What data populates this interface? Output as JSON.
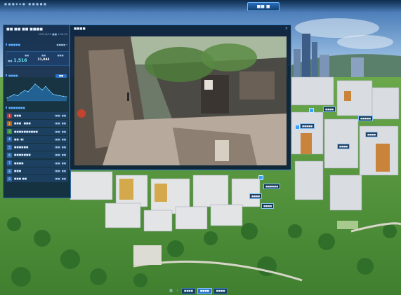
{
  "topbar": {
    "status": "■ ■ ■ ◆ ◆ ■ · ■ ■ ■ ■ ■",
    "title": "■■ ■"
  },
  "left_panel": {
    "title": "■■ ■■ ■■ ■■■■",
    "time": "2021/3/10 ■■ 1:34:40",
    "section1": {
      "title": "■■■■■",
      "right": "■■■■ ▾"
    },
    "stats": {
      "main_label": "■■",
      "main_value": "1,516",
      "cols": [
        {
          "label": "■■",
          "value": ""
        },
        {
          "label": "■■",
          "value": "21,844"
        },
        {
          "label": "■■■",
          "value": ""
        }
      ]
    },
    "section2": {
      "title": "■■■■",
      "button": "■■"
    },
    "chart_data": {
      "type": "area",
      "values": [
        5,
        8,
        11,
        9,
        14,
        18,
        16,
        22,
        29,
        24,
        19,
        25,
        18,
        12,
        10,
        9,
        8,
        7
      ]
    },
    "section3": {
      "title": "■■■■■■■"
    },
    "items": [
      {
        "index": "1",
        "name": "■■■",
        "count": "(■■) ■■",
        "color": "#b03a3a"
      },
      {
        "index": "2",
        "name": "■■■ · ■■■",
        "count": "(■■) ■■",
        "color": "#b5651d"
      },
      {
        "index": "3",
        "name": "■■■■■■■■■■",
        "count": "(■■) ■■",
        "color": "#3a8f3a"
      },
      {
        "index": "4",
        "name": "■■ (■)",
        "count": "(■■) ■■",
        "color": "#2e6db4"
      },
      {
        "index": "5",
        "name": "■■■■■■",
        "count": "(■■) ■■",
        "color": "#2e6db4"
      },
      {
        "index": "6",
        "name": "■■■■■■■",
        "count": "(■■) ■■",
        "color": "#2e6db4"
      },
      {
        "index": "7",
        "name": "■■■■",
        "count": "(■■) ■■",
        "color": "#2e6db4"
      },
      {
        "index": "8",
        "name": "■■■",
        "count": "(■■) ■■",
        "color": "#2e6db4"
      },
      {
        "index": "9",
        "name": "■■■ ■■",
        "count": "(■■) ■■",
        "color": "#2e6db4"
      }
    ]
  },
  "video_window": {
    "title": "■■■■",
    "close_icon": "close-icon"
  },
  "map_tags": [
    "■■■■",
    "■■■■■",
    "■■■■■",
    "■■■■",
    "■■■■",
    "■■■■■■",
    "■■■■",
    "■■■■"
  ],
  "bottom": {
    "tabs": [
      "■■■■",
      "■■■■",
      "■■■■"
    ]
  },
  "colors": {
    "panel_bg": "#0c2442",
    "accent": "#3aa1ff",
    "sky_top": "#5b87c2",
    "grass": "#4f9a3c"
  }
}
